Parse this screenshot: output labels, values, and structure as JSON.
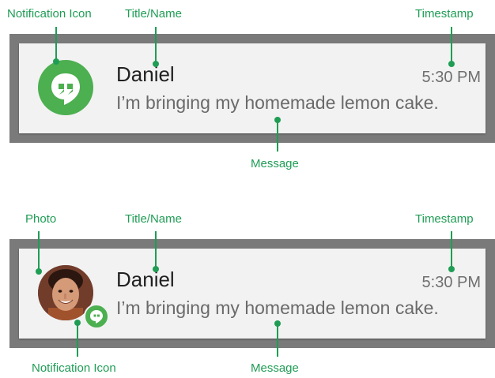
{
  "notification_1": {
    "title": "Daniel",
    "timestamp": "5:30 PM",
    "message": "I’m bringing my homemade lemon cake.",
    "icon": "hangouts-quote-icon"
  },
  "notification_2": {
    "title": "Daniel",
    "timestamp": "5:30 PM",
    "message": "I’m bringing my homemade lemon cake.",
    "photo": "contact-photo",
    "icon": "hangouts-quote-icon"
  },
  "labels": {
    "top": {
      "notification_icon": "Notification Icon",
      "title_name": "Title/Name",
      "timestamp": "Timestamp",
      "message": "Message"
    },
    "bottom": {
      "photo": "Photo",
      "title_name": "Title/Name",
      "timestamp": "Timestamp",
      "notification_icon": "Notification Icon",
      "message": "Message"
    }
  },
  "colors": {
    "accent_green": "#1f9d55",
    "icon_green": "#4caf50",
    "frame_gray": "#7a7a7a",
    "card_bg": "#f2f2f2"
  }
}
